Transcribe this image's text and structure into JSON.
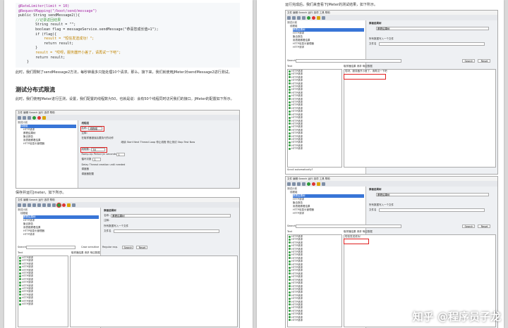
{
  "left_page": {
    "code_lines": [
      {
        "t": "@RateLimiter(limit = 10)",
        "c": "kw"
      },
      {
        "t": "@RequestMapping(\"/boot/send/message\")",
        "c": "kw"
      },
      {
        "t": "public String sendMessage2(){",
        "c": ""
      },
      {
        "t": "        //记录返回结果",
        "c": "cm"
      },
      {
        "t": "        String result = \"\";",
        "c": ""
      },
      {
        "t": "        boolean flag = messageService.sendMessage(\"恭喜您成长值+1\");",
        "c": ""
      },
      {
        "t": "        if (flag){",
        "c": ""
      },
      {
        "t": "            result = \"短信发送成功！\";",
        "c": "st"
      },
      {
        "t": "            return result;",
        "c": ""
      },
      {
        "t": "        }",
        "c": ""
      },
      {
        "t": "        result = \"哎呀，服务器开小差了，请再试一下吧\";",
        "c": "st"
      },
      {
        "t": "        return result;",
        "c": ""
      },
      {
        "t": "    }",
        "c": ""
      }
    ],
    "para1": "此时，我们限制了sendMessage2方法，每秒钟最多只能处理10个请求。那么，接下来，我们就使用JMeter对sendMessage2进行测试。",
    "heading": "测试分布式限流",
    "para2": "此时，我们使用JMeter进行压测，设置，我们配置的线程数为50，也就是说：会有50个线程同时访问我们的接口。JMeter的配置如下所示。",
    "para3": "保存并运行Jmeter，如下所示。"
  },
  "shot1": {
    "menu": "文件  编辑  Search  运行  选项  帮助",
    "tree": [
      "测试计划",
      "线程组",
      "HTTP请求",
      "察看结果树",
      "聚合报告",
      "用表格察看结果",
      "HTTP信息头管理器"
    ],
    "title": "线程组",
    "name_label": "名称：",
    "name_value": "线程组",
    "comment_label": "注释：",
    "error_label": "在取样器错误后要执行的动作",
    "options": "继续  Start Next Thread Loop  停止线程  停止测试  Stop Test Now",
    "threads_label": "线程数：",
    "threads_value": "50",
    "ramp_label": "Ramp-Up Period (in seconds)：",
    "ramp_value": "1",
    "loop_label": "循环次数",
    "loop_value": "1",
    "delay_label": "Delay Thread creation until needed",
    "scheduler_label": "调度器",
    "scheduler_cfg": "调度器配置"
  },
  "shot2": {
    "menu": "文件  编辑  Search  运行  选项  帮助",
    "tree": [
      "测试计划",
      "线程组",
      "察看结果树",
      "HTTP请求",
      "聚合报告",
      "用表格察看结果",
      "HTTP信息头管理器",
      "HTTP请求"
    ],
    "title": "察看结果树",
    "name_label": "名称：",
    "name_value": "察看结果树",
    "comment_label": "注释：",
    "file_label": "所有数据写入一个文件",
    "filename_label": "文件名",
    "search_label": "Search:",
    "case_label": "Case sensitive",
    "regex_label": "Regular exp.",
    "search_btn": "Search",
    "reset_btn": "Reset",
    "text_label": "Text",
    "tabs": "取样器结果  请求  响应数据",
    "run_label": "运行",
    "run_hint": "运行JMeter",
    "item": "HTTP请求",
    "item_count": 16
  },
  "shot3": {
    "menu": "文件  编辑  Search  运行  选项  工具  帮助",
    "tree": [
      "测试计划",
      "线程组",
      "察看结果树",
      "HTTP请求",
      "聚合报告",
      "用表格察看结果",
      "HTTP信息头管理器",
      "HTTP请求"
    ],
    "title": "察看结果树",
    "name_value": "察看结果树",
    "file_label": "所有数据写入一个文件",
    "filename_label": "文件名",
    "search_label": "Search:",
    "search_btn": "Search",
    "reset_btn": "Reset",
    "text_label": "Text",
    "tabs": "取样器结果  请求  响应数据",
    "response": "哎呀，服务器开小差了，请再试一下吧",
    "item": "HTTP请求",
    "item_count": 26,
    "footer": "Scroll automatically?"
  },
  "shot4": {
    "menu": "文件  编辑  Search  运行  选项  工具  帮助",
    "tree": [
      "测试计划",
      "线程组",
      "察看结果树",
      "HTTP请求",
      "聚合报告",
      "用表格察看结果",
      "HTTP信息头管理器",
      "HTTP请求"
    ],
    "title": "察看结果树",
    "name_value": "察看结果树",
    "file_label": "所有数据写入一个文件",
    "filename_label": "文件名",
    "search_label": "Search:",
    "search_btn": "Search",
    "reset_btn": "Reset",
    "text_label": "Text",
    "tabs": "取样器结果  请求  响应数据",
    "response": "短信发送成功！",
    "item": "HTTP请求",
    "item_count": 28
  },
  "right_page": {
    "para1": "运行完成后，我们来查看下JMeter的测试结果，如下所示。"
  },
  "watermark": "知乎 @程序员子龙"
}
